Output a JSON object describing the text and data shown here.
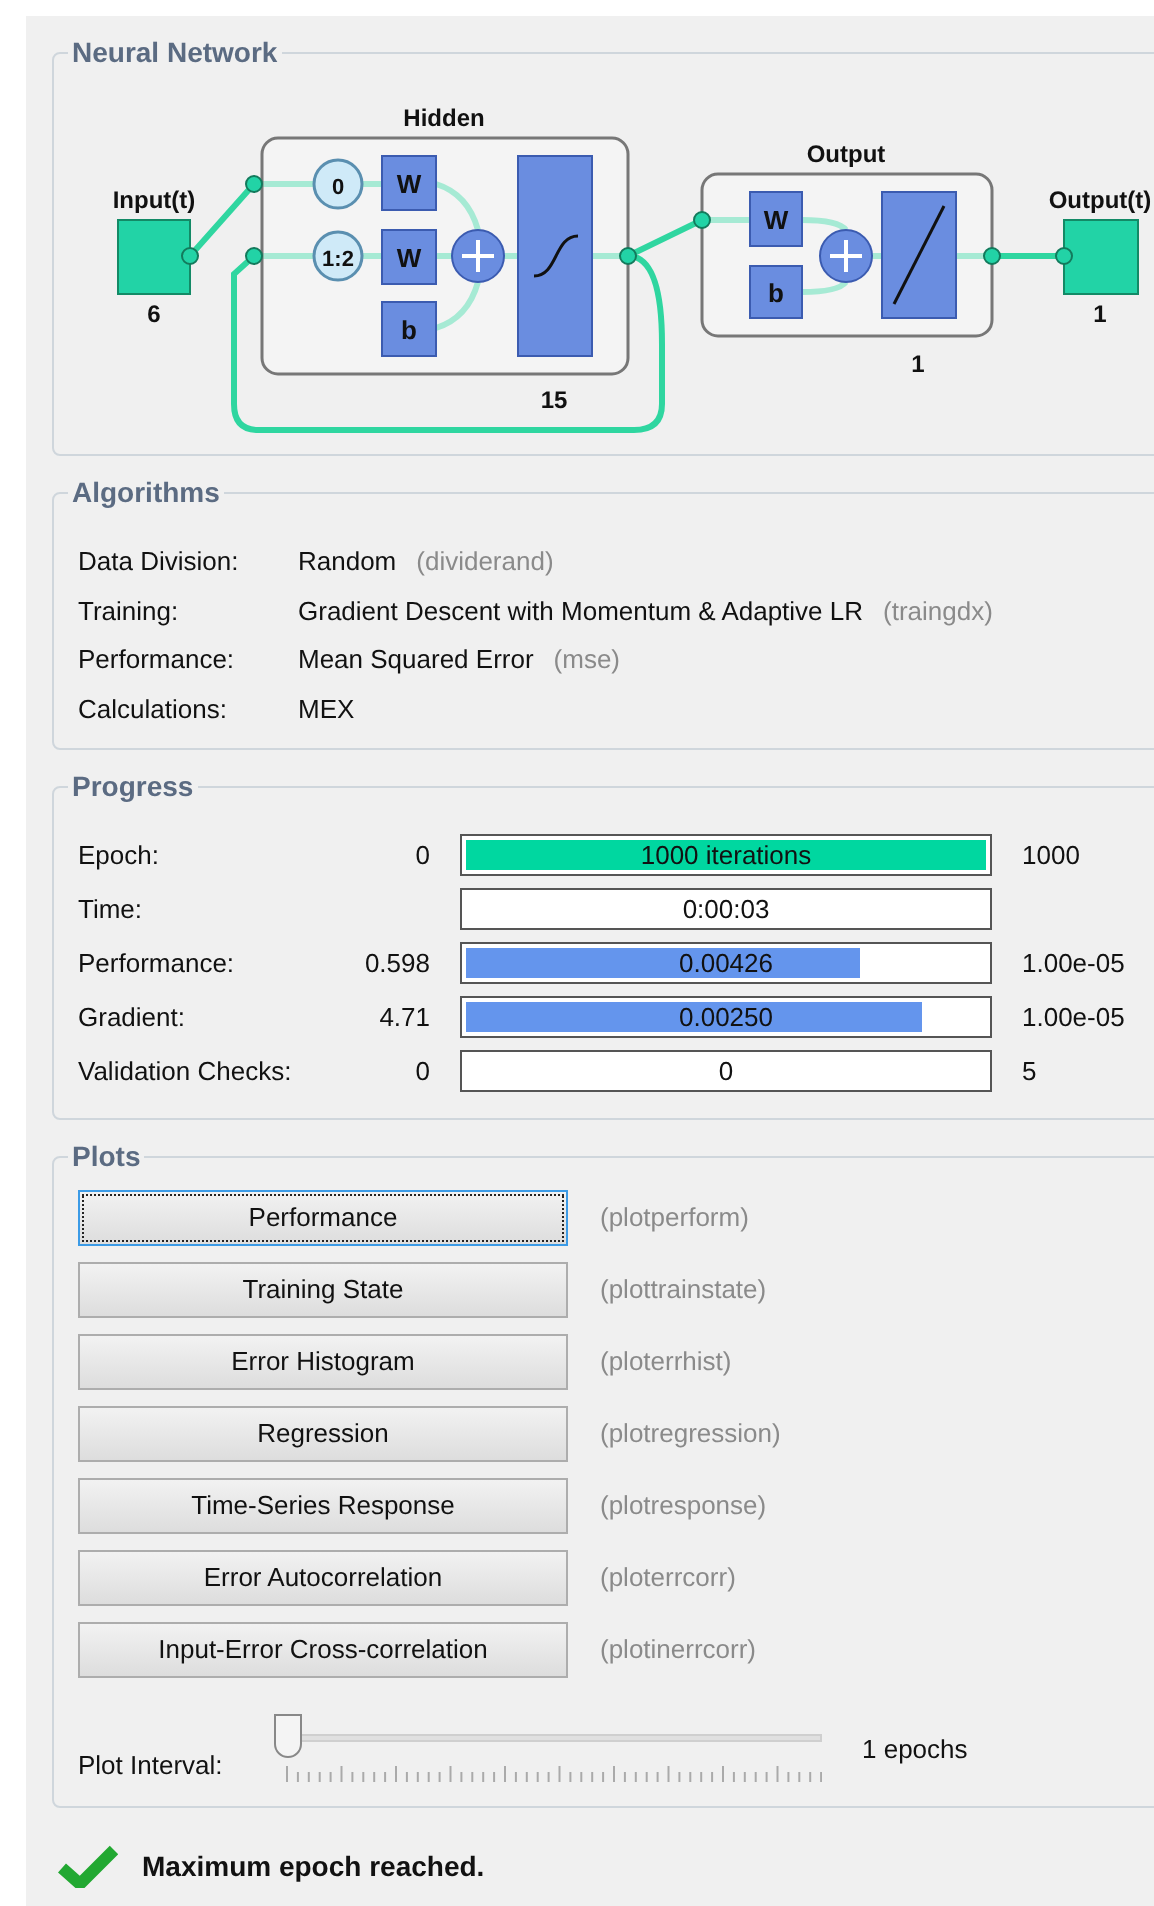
{
  "network": {
    "title": "Neural Network",
    "input": {
      "label": "Input(t)",
      "size": "6"
    },
    "hidden": {
      "label": "Hidden",
      "delays": [
        "0",
        "1:2"
      ],
      "weights": [
        "W",
        "W"
      ],
      "bias": "b",
      "size": "15"
    },
    "output_layer": {
      "label": "Output",
      "weight": "W",
      "bias": "b",
      "size": "1"
    },
    "output": {
      "label": "Output(t)",
      "size": "1"
    }
  },
  "algorithms": {
    "title": "Algorithms",
    "rows": [
      {
        "label": "Data Division:",
        "value": "Random",
        "function": "(dividerand)"
      },
      {
        "label": "Training:",
        "value": "Gradient Descent with Momentum & Adaptive LR",
        "function": "(traingdx)"
      },
      {
        "label": "Performance:",
        "value": "Mean Squared Error",
        "function": "(mse)"
      },
      {
        "label": "Calculations:",
        "value": "MEX"
      }
    ]
  },
  "progress": {
    "title": "Progress",
    "rows": [
      {
        "label": "Epoch:",
        "start": "0",
        "reading": "1000 iterations",
        "level": 1,
        "color": "#00d7a0",
        "end": "1000"
      },
      {
        "label": "Time:",
        "reading": "0:00:03"
      },
      {
        "label": "Performance:",
        "start": "0.598",
        "reading": "0.00426",
        "level": 0.76,
        "color": "#6495ed",
        "end": "1.00e-05"
      },
      {
        "label": "Gradient:",
        "start": "4.71",
        "reading": "0.00250",
        "level": 0.88,
        "color": "#6495ed",
        "end": "1.00e-05"
      },
      {
        "label": "Validation Checks:",
        "start": "0",
        "reading": "0",
        "end": "5"
      }
    ]
  },
  "plots": {
    "title": "Plots",
    "buttons": [
      {
        "label": "Performance",
        "function": "(plotperform)",
        "focused": true
      },
      {
        "label": "Training State",
        "function": "(plottrainstate)",
        "focused": false
      },
      {
        "label": "Error Histogram",
        "function": "(ploterrhist)",
        "focused": false
      },
      {
        "label": "Regression",
        "function": "(plotregression)",
        "focused": false
      },
      {
        "label": "Time-Series Response",
        "function": "(plotresponse)",
        "focused": false
      },
      {
        "label": "Error Autocorrelation",
        "function": "(ploterrcorr)",
        "focused": false
      },
      {
        "label": "Input-Error Cross-correlation",
        "function": "(plotinerrcorr)",
        "focused": false
      }
    ],
    "interval": {
      "label": "Plot Interval:",
      "level": 0,
      "reading": "1 epochs"
    }
  },
  "status": {
    "message": "Maximum epoch reached."
  }
}
